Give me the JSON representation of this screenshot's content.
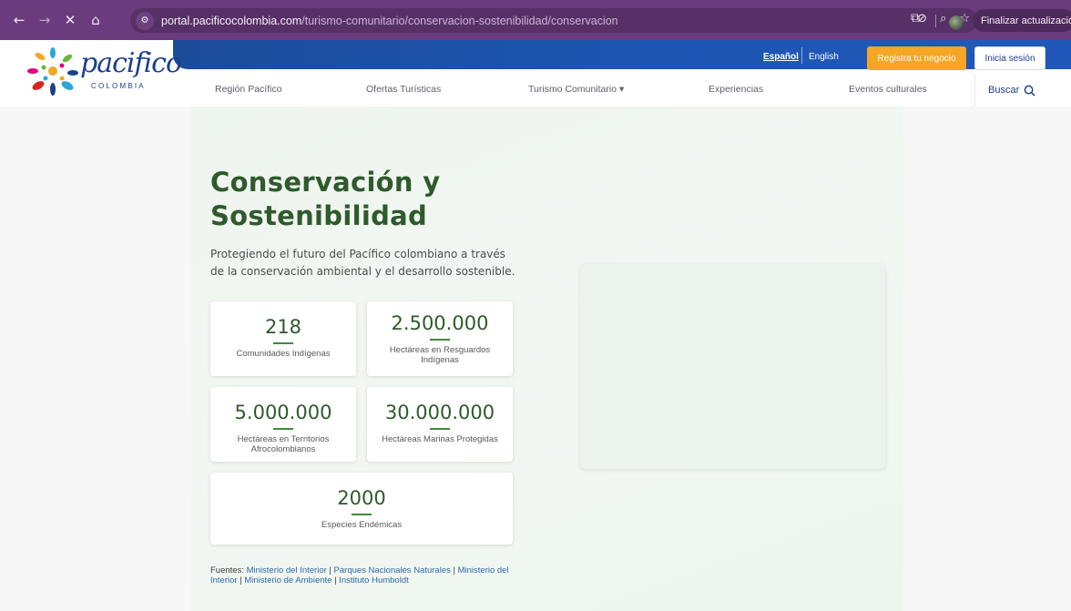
{
  "browser": {
    "url_host": "portal.pacificocolombia.com",
    "url_path": "/turismo-comunitario/conservacion-sostenibilidad/conservacion",
    "update_button": "Finalizar actualización",
    "icons": [
      "back-icon",
      "forward-icon",
      "close-icon",
      "home-icon",
      "site-info-icon",
      "eye-off-icon",
      "zoom-icon",
      "star-icon",
      "extensions-icon",
      "profile-avatar"
    ]
  },
  "header": {
    "logo_word": "pacifico",
    "logo_sub": "COLOMBIA",
    "lang_es": "Español",
    "lang_en": "English",
    "register_button": "Registra tu negocio",
    "login_button": "Inicia sesión",
    "menu": [
      {
        "label": "Región Pacífico"
      },
      {
        "label": "Ofertas Turísticas"
      },
      {
        "label": "Turismo Comunitario ▾"
      },
      {
        "label": "Experiencias"
      },
      {
        "label": "Eventos culturales"
      }
    ],
    "search_label": "Buscar",
    "colors": {
      "band": "#1d56b3",
      "register": "#f5a623"
    }
  },
  "main": {
    "title": "Conservación y Sostenibilidad",
    "subtitle": "Protegiendo el futuro del Pacífico colombiano a través de la conservación ambiental y el desarrollo sostenible.",
    "stats": [
      {
        "value": "218",
        "label": "Comunidades Indígenas"
      },
      {
        "value": "2.500.000",
        "label": "Hectáreas en Resguardos Indígenas"
      },
      {
        "value": "5.000.000",
        "label": "Hectáreas en Territorios Afrocolombianos"
      },
      {
        "value": "30.000.000",
        "label": "Hectáreas Marinas Protegidas"
      },
      {
        "value": "2000",
        "label": "Especies Endémicas"
      }
    ],
    "sources_prefix": "Fuentes:",
    "sources": [
      "Ministerio del Interior",
      "Parques Nacionales Naturales",
      "Ministerio del Interior",
      "Ministerio de Ambiente",
      "Instituto Humboldt"
    ],
    "accent_color": "#2f5a2c"
  }
}
